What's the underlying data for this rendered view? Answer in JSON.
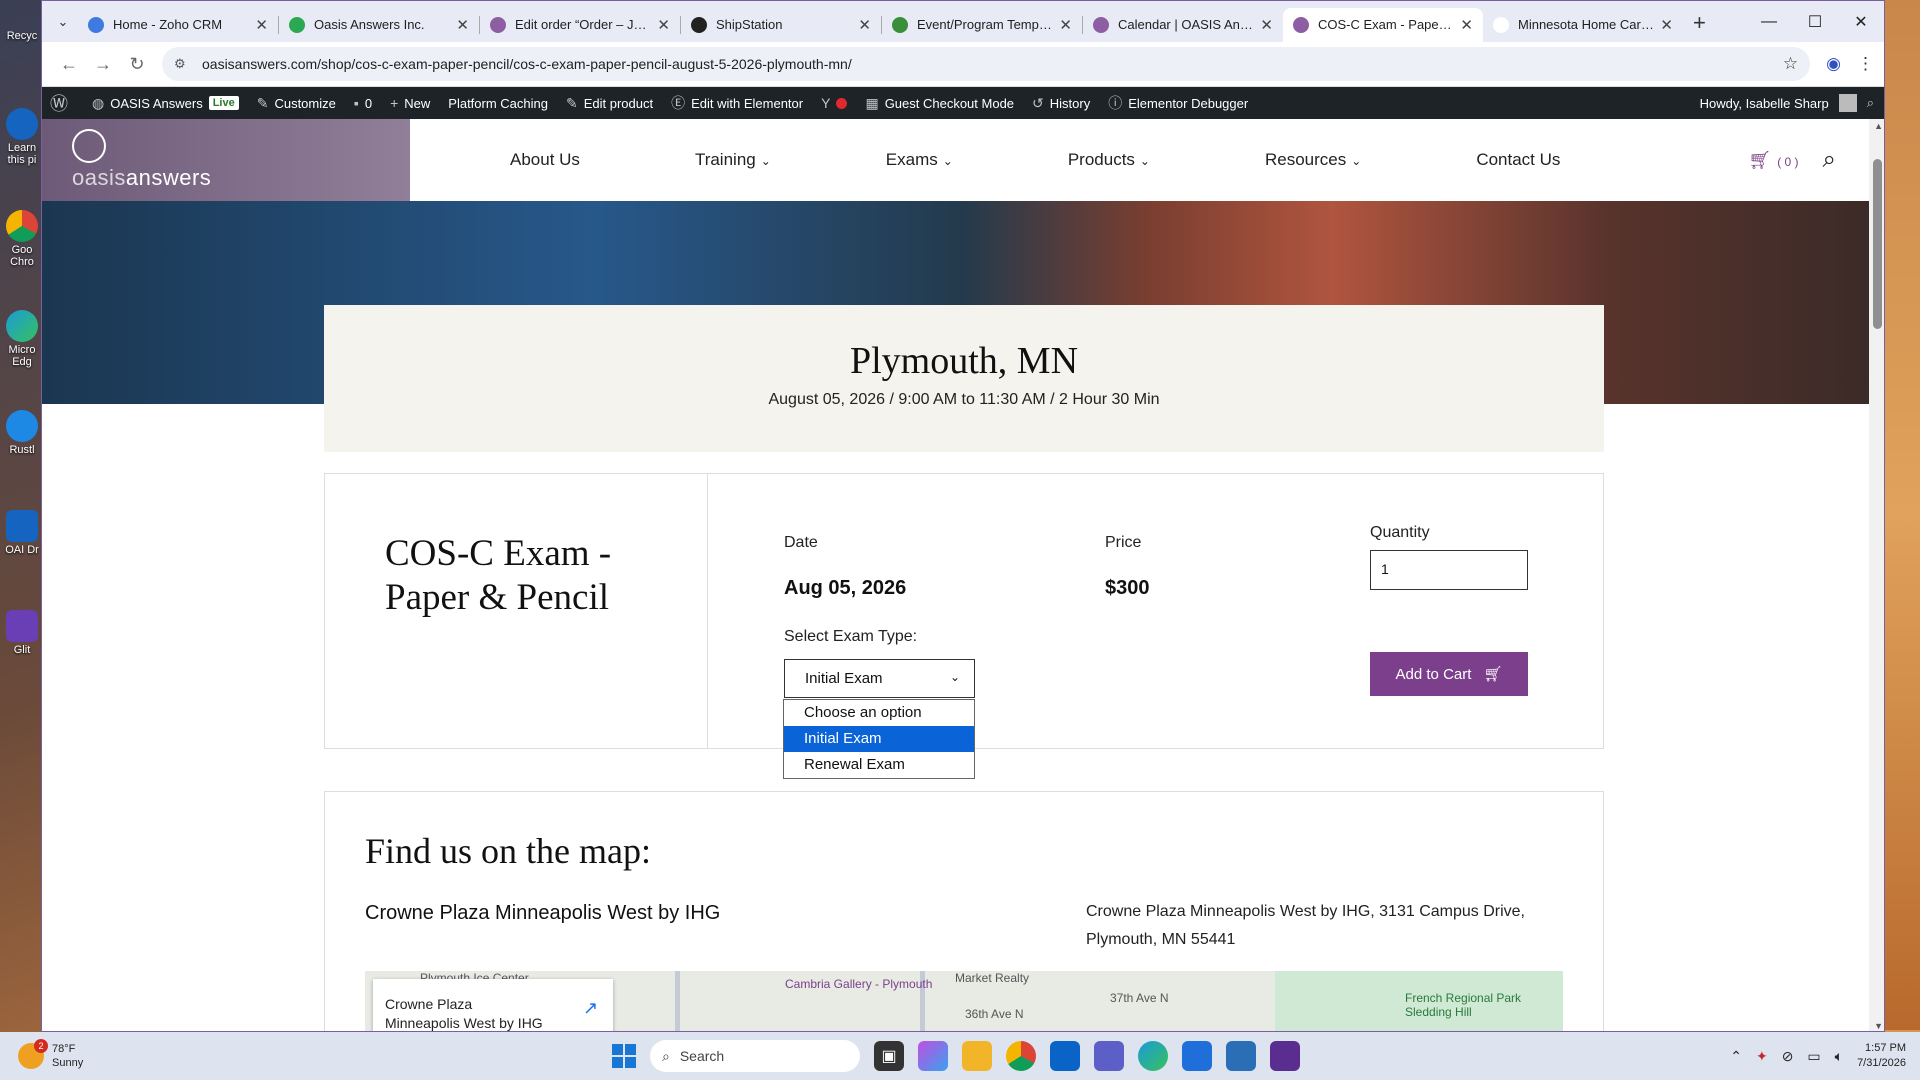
{
  "browser": {
    "tabs": [
      {
        "title": "Home - Zoho CRM",
        "color": "#3d7be0"
      },
      {
        "title": "Oasis Answers Inc.",
        "color": "#2aa852"
      },
      {
        "title": "Edit order “Order – Janu",
        "color": "#8e5ea2"
      },
      {
        "title": "ShipStation",
        "color": "#222222"
      },
      {
        "title": "Event/Program Template",
        "color": "#3a8f3a"
      },
      {
        "title": "Calendar | OASIS Answer",
        "color": "#8e5ea2"
      },
      {
        "title": "COS-C Exam - Paper & P",
        "color": "#8e5ea2"
      },
      {
        "title": "Minnesota Home Care A",
        "color": "#ffffff"
      }
    ],
    "url": "oasisanswers.com/shop/cos-c-exam-paper-pencil/cos-c-exam-paper-pencil-august-5-2026-plymouth-mn/"
  },
  "wpbar": {
    "site": "OASIS Answers",
    "live": "Live",
    "customize": "Customize",
    "comments": "0",
    "new": "New",
    "caching": "Platform Caching",
    "edit_product": "Edit product",
    "elementor": "Edit with Elementor",
    "guest": "Guest Checkout Mode",
    "history": "History",
    "debugger": "Elementor Debugger",
    "howdy": "Howdy, Isabelle Sharp"
  },
  "site": {
    "logo_a": "oasis",
    "logo_b": "answers",
    "nav": [
      "About Us",
      "Training",
      "Exams",
      "Products",
      "Resources",
      "Contact Us"
    ],
    "cart_count": "( 0 )"
  },
  "event": {
    "city": "Plymouth, MN",
    "when": "August 05, 2026 / 9:00 AM to 11:30 AM / 2 Hour 30 Min"
  },
  "product": {
    "name": "COS-C Exam - Paper & Pencil",
    "date_label": "Date",
    "date_value": "Aug 05, 2026",
    "price_label": "Price",
    "price_value": "$300",
    "qty_label": "Quantity",
    "qty_value": "1",
    "type_label": "Select Exam Type:",
    "type_value": "Initial Exam",
    "options": [
      "Choose an option",
      "Initial Exam",
      "Renewal Exam"
    ],
    "add_to_cart": "Add to Cart"
  },
  "map": {
    "heading": "Find us on the map:",
    "venue": "Crowne Plaza Minneapolis West by IHG",
    "address": "Crowne Plaza Minneapolis West by IHG, 3131 Campus Drive, Plymouth, MN 55441",
    "card": "Crowne Plaza Minneapolis West by IHG",
    "labels": [
      "Plymouth Ice Center",
      "Cambria Gallery - Plymouth",
      "Market Realty",
      "37th Ave N",
      "36th Ave N",
      "French Regional Park Sledding Hill"
    ]
  },
  "taskbar": {
    "temp": "78°F",
    "cond": "Sunny",
    "badge": "2",
    "search": "Search",
    "time": "1:57 PM",
    "date": "7/31/2026"
  },
  "desktop": [
    "Recyc",
    "Learn this pi",
    "Goo Chro",
    "Micro Edg",
    "Rustl",
    "OAI Dr",
    "Glit"
  ]
}
